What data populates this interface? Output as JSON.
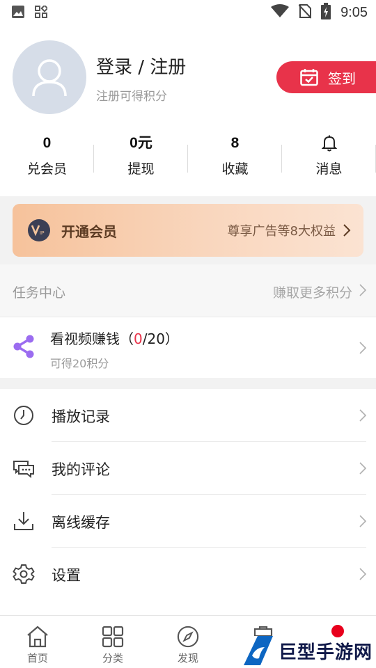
{
  "status_bar": {
    "time": "9:05",
    "icons": [
      "image-icon",
      "apps-icon",
      "wifi-icon",
      "no-sim-icon",
      "battery-charging-icon"
    ]
  },
  "profile": {
    "login_title": "登录 / 注册",
    "login_subtitle": "注册可得积分",
    "checkin_label": "签到"
  },
  "stats": [
    {
      "value": "0",
      "label": "兑会员"
    },
    {
      "value": "0元",
      "label": "提现"
    },
    {
      "value": "8",
      "label": "收藏"
    },
    {
      "value": "",
      "label": "消息"
    }
  ],
  "vip_banner": {
    "title": "开通会员",
    "description": "尊享广告等8大权益"
  },
  "task_center": {
    "title": "任务中心",
    "link": "赚取更多积分",
    "task": {
      "name_prefix": "看视频赚钱（",
      "done": "0",
      "name_suffix": "/20）",
      "subtitle": "可得20积分"
    }
  },
  "menu": [
    {
      "label": "播放记录",
      "icon": "clock-icon"
    },
    {
      "label": "我的评论",
      "icon": "comment-icon"
    },
    {
      "label": "离线缓存",
      "icon": "download-icon"
    },
    {
      "label": "设置",
      "icon": "gear-icon"
    }
  ],
  "bottom_nav": [
    {
      "label": "首页",
      "icon": "home-icon"
    },
    {
      "label": "分类",
      "icon": "grid-icon"
    },
    {
      "label": "发现",
      "icon": "compass-icon"
    }
  ],
  "watermark": {
    "text": "巨型手游网"
  },
  "colors": {
    "accent_red": "#e8334a",
    "vip_gradient_start": "#f6c29b",
    "vip_text": "#5b3a22"
  }
}
